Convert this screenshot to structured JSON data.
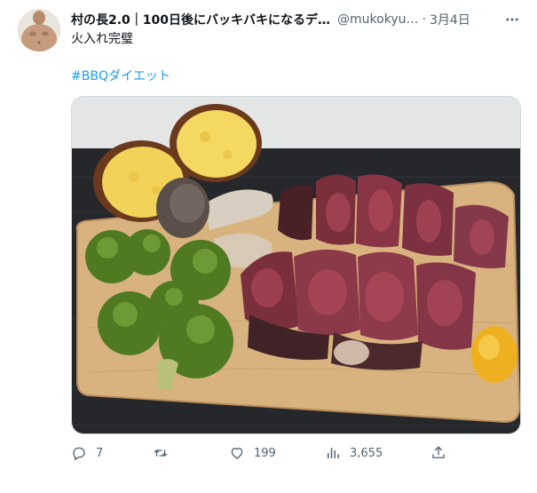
{
  "tweet": {
    "author_name": "村の長2.0｜100日後にバッキバキになるデ…",
    "handle": "@mukokyu…",
    "separator": "·",
    "date": "3月4日",
    "text": "火入れ完璧",
    "hashtag": "#BBQダイエット"
  },
  "actions": {
    "replies": "7",
    "retweets": "",
    "likes": "199",
    "views": "3,655"
  },
  "icons": {
    "more": "more-icon",
    "reply": "reply-icon",
    "retweet": "retweet-icon",
    "like": "heart-icon",
    "views": "views-icon",
    "share": "share-icon"
  },
  "colors": {
    "link": "#1d9bf0",
    "secondary": "#536471",
    "text": "#0f1419"
  }
}
